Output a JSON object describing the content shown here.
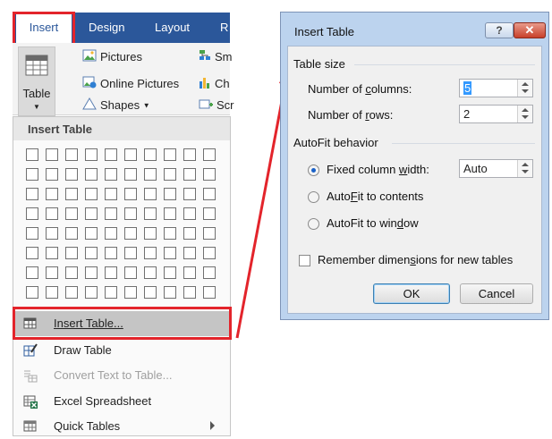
{
  "ribbon": {
    "tabs": [
      {
        "label": "Insert",
        "active": true
      },
      {
        "label": "Design",
        "active": false
      },
      {
        "label": "Layout",
        "active": false
      },
      {
        "label": "R",
        "active": false
      }
    ],
    "table_button": "Table",
    "items": [
      {
        "label": "Pictures",
        "icon": "pictures-icon"
      },
      {
        "label": "Online Pictures",
        "icon": "online-pictures-icon"
      },
      {
        "label": "Shapes",
        "icon": "shapes-icon"
      },
      {
        "label": "Sm",
        "icon": "smartart-icon"
      },
      {
        "label": "Ch",
        "icon": "chart-icon"
      },
      {
        "label": "Scr",
        "icon": "screenshot-icon"
      }
    ]
  },
  "dropdown": {
    "header": "Insert Table",
    "grid": {
      "columns": 10,
      "rows": 8
    },
    "menu": [
      {
        "label": "Insert Table...",
        "icon": "insert-table-icon",
        "disabled": false,
        "selected": true
      },
      {
        "label": "Draw Table",
        "icon": "draw-table-icon",
        "disabled": false
      },
      {
        "label": "Convert Text to Table...",
        "icon": "convert-text-icon",
        "disabled": true
      },
      {
        "label": "Excel Spreadsheet",
        "icon": "excel-icon",
        "disabled": false
      },
      {
        "label": "Quick Tables",
        "icon": "quick-tables-icon",
        "disabled": false,
        "submenu": true
      }
    ]
  },
  "dialog": {
    "title": "Insert Table",
    "help": "?",
    "close": "✕",
    "table_size": {
      "label": "Table size",
      "columns_label": "Number of columns:",
      "columns_value": "5",
      "rows_label": "Number of rows:",
      "rows_value": "2"
    },
    "autofit": {
      "label": "AutoFit behavior",
      "fixed_label": "Fixed column width:",
      "fixed_value": "Auto",
      "contents_label": "AutoFit to contents",
      "window_label": "AutoFit to window",
      "selected": "fixed"
    },
    "remember_label": "Remember dimensions for new tables",
    "remember_checked": false,
    "ok": "OK",
    "cancel": "Cancel"
  },
  "colors": {
    "ribbon_blue": "#2b579a",
    "annotation_red": "#e3242b",
    "dialog_frame": "#bcd3ee"
  }
}
